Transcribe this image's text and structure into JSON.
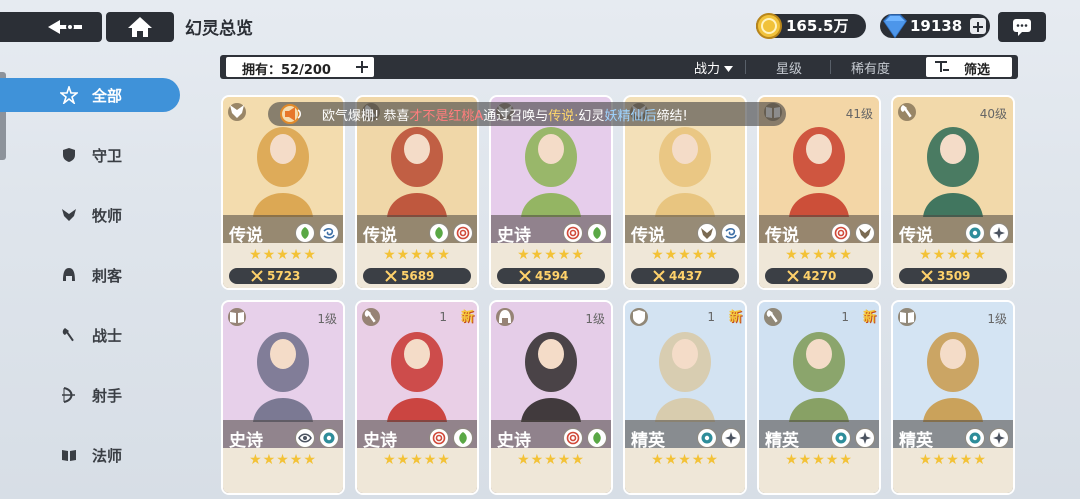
{
  "header": {
    "title": "幻灵总览",
    "gold": "165.5万",
    "gems": "19138"
  },
  "filter": {
    "owned_label": "拥有：52/200",
    "sorts": [
      "战力",
      "星级",
      "稀有度"
    ],
    "filter_label": "筛选"
  },
  "sidebar": {
    "items": [
      {
        "label": "全部",
        "icon": "star-icon",
        "active": true
      },
      {
        "label": "守卫",
        "icon": "shield-icon",
        "active": false
      },
      {
        "label": "牧师",
        "icon": "wings-icon",
        "active": false
      },
      {
        "label": "刺客",
        "icon": "hood-icon",
        "active": false
      },
      {
        "label": "战士",
        "icon": "axe-icon",
        "active": false
      },
      {
        "label": "射手",
        "icon": "bow-icon",
        "active": false
      },
      {
        "label": "法师",
        "icon": "book-icon",
        "active": false
      }
    ]
  },
  "announcement": {
    "parts": [
      {
        "text": "欧气爆棚! 恭喜",
        "style": "white"
      },
      {
        "text": "才不是红桃A",
        "style": "red"
      },
      {
        "text": "通过召唤与",
        "style": "white"
      },
      {
        "text": "传说·",
        "style": "yellow"
      },
      {
        "text": "幻灵",
        "style": "white"
      },
      {
        "text": "妖精仙后",
        "style": "blue"
      },
      {
        "text": "缔结!",
        "style": "white"
      }
    ]
  },
  "heroes": [
    {
      "rarity": "传说",
      "level": "",
      "power": "5723",
      "stars": "★★★★★",
      "is_new": false,
      "bg": "#f3dcae",
      "accent": "#d9a24a",
      "class_icon": "priest-icon",
      "elements": [
        "leaf-icon",
        "wind-icon"
      ]
    },
    {
      "rarity": "传说",
      "level": "",
      "power": "5689",
      "stars": "★★★★★",
      "is_new": false,
      "bg": "#f0d7a8",
      "accent": "#b94a32",
      "class_icon": "warrior-icon",
      "elements": [
        "leaf-icon",
        "swirl-icon"
      ]
    },
    {
      "rarity": "史诗",
      "level": "",
      "power": "4594",
      "stars": "★★★★★",
      "is_new": false,
      "bg": "#e6cdeb",
      "accent": "#8bb354",
      "class_icon": "priest-icon",
      "elements": [
        "swirl-icon",
        "leaf-icon"
      ]
    },
    {
      "rarity": "传说",
      "level": "",
      "power": "4437",
      "stars": "★★★★★",
      "is_new": false,
      "bg": "#f3e0b8",
      "accent": "#e7c27a",
      "class_icon": "priest-icon",
      "elements": [
        "wing-icon",
        "wind-icon"
      ]
    },
    {
      "rarity": "传说",
      "level": "41级",
      "power": "4270",
      "stars": "★★★★★",
      "is_new": false,
      "bg": "#f3d6a6",
      "accent": "#c8402e",
      "class_icon": "mage-icon",
      "elements": [
        "swirl-icon",
        "wing-icon"
      ]
    },
    {
      "rarity": "传说",
      "level": "40级",
      "power": "3509",
      "stars": "★★★★★",
      "is_new": false,
      "bg": "#f2d9aa",
      "accent": "#2d6a56",
      "class_icon": "warrior-icon",
      "elements": [
        "water-icon",
        "sparkle-icon"
      ]
    },
    {
      "rarity": "史诗",
      "level": "1级",
      "power": "",
      "stars": "★★★★★",
      "is_new": false,
      "bg": "#e7d0ea",
      "accent": "#6f6f8a",
      "class_icon": "mage-icon",
      "elements": [
        "eye-icon",
        "water-icon"
      ]
    },
    {
      "rarity": "史诗",
      "level": "1",
      "power": "",
      "stars": "★★★★★",
      "is_new": true,
      "bg": "#e9cfe6",
      "accent": "#c8352f",
      "class_icon": "warrior-icon",
      "elements": [
        "swirl-icon",
        "leaf-icon"
      ]
    },
    {
      "rarity": "史诗",
      "level": "1级",
      "power": "",
      "stars": "★★★★★",
      "is_new": false,
      "bg": "#e5cde8",
      "accent": "#2f2a2a",
      "class_icon": "assassin-icon",
      "elements": [
        "swirl-icon",
        "leaf-icon"
      ]
    },
    {
      "rarity": "精英",
      "level": "1",
      "power": "",
      "stars": "★★★★★",
      "is_new": true,
      "bg": "#d3e3f2",
      "accent": "#d8c9a6",
      "class_icon": "guard-icon",
      "elements": [
        "water-icon",
        "sparkle-icon"
      ]
    },
    {
      "rarity": "精英",
      "level": "1",
      "power": "",
      "stars": "★★★★★",
      "is_new": true,
      "bg": "#d0e1f2",
      "accent": "#7f9a55",
      "class_icon": "warrior-icon",
      "elements": [
        "water-icon",
        "sparkle-icon"
      ]
    },
    {
      "rarity": "精英",
      "level": "1级",
      "power": "",
      "stars": "★★★★★",
      "is_new": false,
      "bg": "#d4e4f3",
      "accent": "#c99a4a",
      "class_icon": "mage-icon",
      "elements": [
        "water-icon",
        "sparkle-icon"
      ]
    }
  ]
}
